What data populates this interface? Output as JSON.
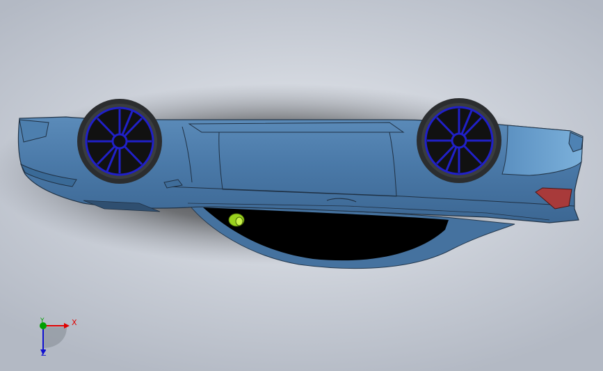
{
  "viewport": {
    "background_top": "#e8ebf0",
    "background_bottom": "#b3b9c4"
  },
  "model": {
    "body_color": "#4a79a8",
    "body_highlight": "#6fa2cf",
    "rim_color": "#2020c8",
    "tire_color": "#2b2d2f",
    "taillight_color": "#a83a3a",
    "gizmo_color": "#9ad21e"
  },
  "triad": {
    "x_label": "X",
    "y_label": "Y",
    "z_label": "Z",
    "x_color": "#e00000",
    "y_color": "#00a000",
    "z_color": "#1010d0"
  }
}
